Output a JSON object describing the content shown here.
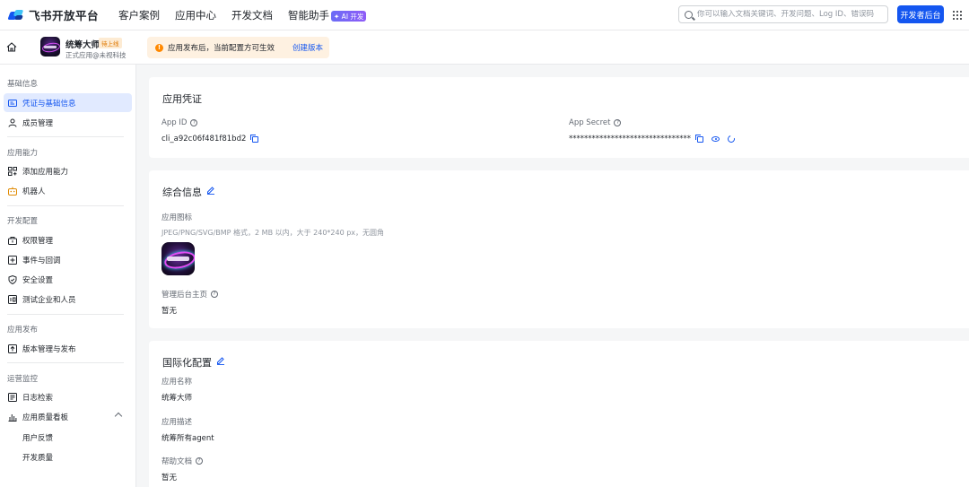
{
  "topnav": {
    "brand": "飞书开放平台",
    "items": [
      "客户案例",
      "应用中心",
      "开发文档",
      "智能助手"
    ],
    "ai_badge": "✦ AI 开发",
    "search_placeholder": "你可以输入文档关键词、开发问题、Log ID、错误码",
    "dev_console": "开发者后台"
  },
  "appbar": {
    "app_name": "统筹大师",
    "status": "待上线",
    "subtitle": "正式应用@未视科技",
    "notice": "应用发布后，当前配置方可生效",
    "notice_link": "创建版本"
  },
  "sidebar": {
    "groups": [
      {
        "title": "基础信息",
        "items": [
          "凭证与基础信息",
          "成员管理"
        ]
      },
      {
        "title": "应用能力",
        "items": [
          "添加应用能力",
          "机器人"
        ]
      },
      {
        "title": "开发配置",
        "items": [
          "权限管理",
          "事件与回调",
          "安全设置",
          "测试企业和人员"
        ]
      },
      {
        "title": "应用发布",
        "items": [
          "版本管理与发布"
        ]
      },
      {
        "title": "运营监控",
        "items": [
          "日志检索",
          "应用质量看板"
        ],
        "subitems": [
          "用户反馈",
          "开发质量"
        ]
      }
    ],
    "active": "凭证与基础信息"
  },
  "credentials": {
    "title": "应用凭证",
    "app_id_label": "App ID",
    "app_id": "cli_a92c06f481f81bd2",
    "app_secret_label": "App Secret",
    "app_secret": "********************************"
  },
  "general": {
    "title": "综合信息",
    "icon_label": "应用图标",
    "icon_hint": "JPEG/PNG/SVG/BMP 格式，2 MB 以内，大于 240*240 px，无圆角",
    "homepage_label": "管理后台主页",
    "homepage_value": "暂无"
  },
  "i18n": {
    "title": "国际化配置",
    "name_label": "应用名称",
    "name_value": "统筹大师",
    "desc_label": "应用描述",
    "desc_value": "统筹所有agent",
    "help_label": "帮助文档",
    "help_value": "暂无"
  },
  "colors": {
    "accent": "#1456f0",
    "active_bg": "#e1eaff",
    "warning": "#ff8800",
    "notice_bg": "#fef1e1"
  }
}
